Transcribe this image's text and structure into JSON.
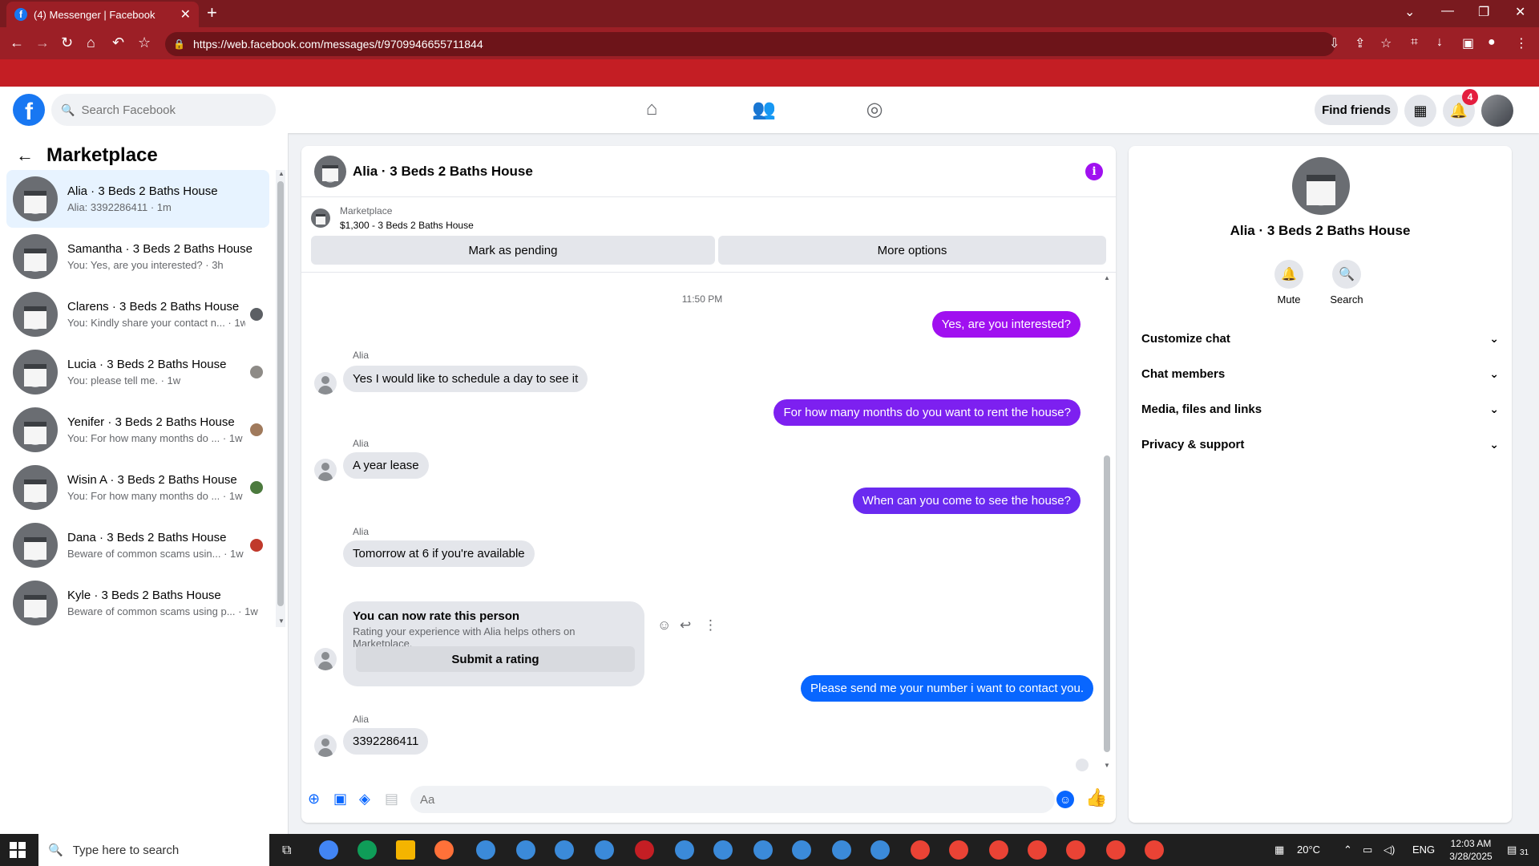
{
  "browser": {
    "tab_title": "(4) Messenger | Facebook",
    "url": "https://web.facebook.com/messages/t/9709946655711844"
  },
  "fb_header": {
    "search_placeholder": "Search Facebook",
    "find_friends": "Find friends",
    "notification_count": "4"
  },
  "sidebar": {
    "title": "Marketplace",
    "conversations": [
      {
        "name": "Alia · 3 Beds 2 Baths House",
        "preview": "Alia: 3392286411 · 1m"
      },
      {
        "name": "Samantha · 3 Beds 2 Baths House",
        "preview": "You: Yes, are you interested? · 3h"
      },
      {
        "name": "Clarens · 3 Beds 2 Baths House",
        "preview": "You: Kindly share your contact n... · 1w"
      },
      {
        "name": "Lucia · 3 Beds 2 Baths House",
        "preview": "You: please tell me. · 1w"
      },
      {
        "name": "Yenifer · 3 Beds 2 Baths House",
        "preview": "You: For how many months do ... · 1w"
      },
      {
        "name": "Wisin A · 3 Beds 2 Baths House",
        "preview": "You: For how many months do ... · 1w"
      },
      {
        "name": "Dana · 3 Beds 2 Baths House",
        "preview": "Beware of common scams usin... · 1w"
      },
      {
        "name": "Kyle · 3 Beds 2 Baths House",
        "preview": "Beware of common scams using p... · 1w"
      }
    ]
  },
  "chat": {
    "title": "Alia · 3 Beds 2 Baths House",
    "listing_label": "Marketplace",
    "listing_price": "$1,300 - 3 Beds 2 Baths House",
    "mark_pending": "Mark as pending",
    "more_options": "More options",
    "timestamp": "11:50 PM",
    "sender_name": "Alia",
    "msg_out_1": "Yes, are you interested?",
    "msg_in_1": "Yes I would like to schedule a day to see it",
    "msg_out_2": "For how many months do you want to rent the house?",
    "msg_in_2": "A year lease",
    "msg_out_3": "When can you come to see the house?",
    "msg_in_3": "Tomorrow at 6 if you're available",
    "rate_title": "You can now rate this person",
    "rate_sub": "Rating your experience with Alia helps others on Marketplace.",
    "rate_button": "Submit a rating",
    "msg_out_4": "Please send me your number i want to contact you.",
    "msg_in_4": "3392286411",
    "composer_placeholder": "Aa"
  },
  "right_panel": {
    "name": "Alia · 3 Beds 2 Baths House",
    "mute": "Mute",
    "search": "Search",
    "sections": [
      "Customize chat",
      "Chat members",
      "Media, files and links",
      "Privacy & support"
    ]
  },
  "taskbar": {
    "search_placeholder": "Type here to search",
    "temperature": "20°C",
    "language": "ENG",
    "time": "12:03 AM",
    "date": "3/28/2025",
    "notif_count": "31"
  },
  "colors": {
    "chrome_dark": "#7a1a1f",
    "chrome": "#9c1f26",
    "fb_blue": "#1877f2",
    "bubble_purple": "#a010f0",
    "bubble_violet": "#6a2af0",
    "bubble_blue": "#0866ff"
  }
}
